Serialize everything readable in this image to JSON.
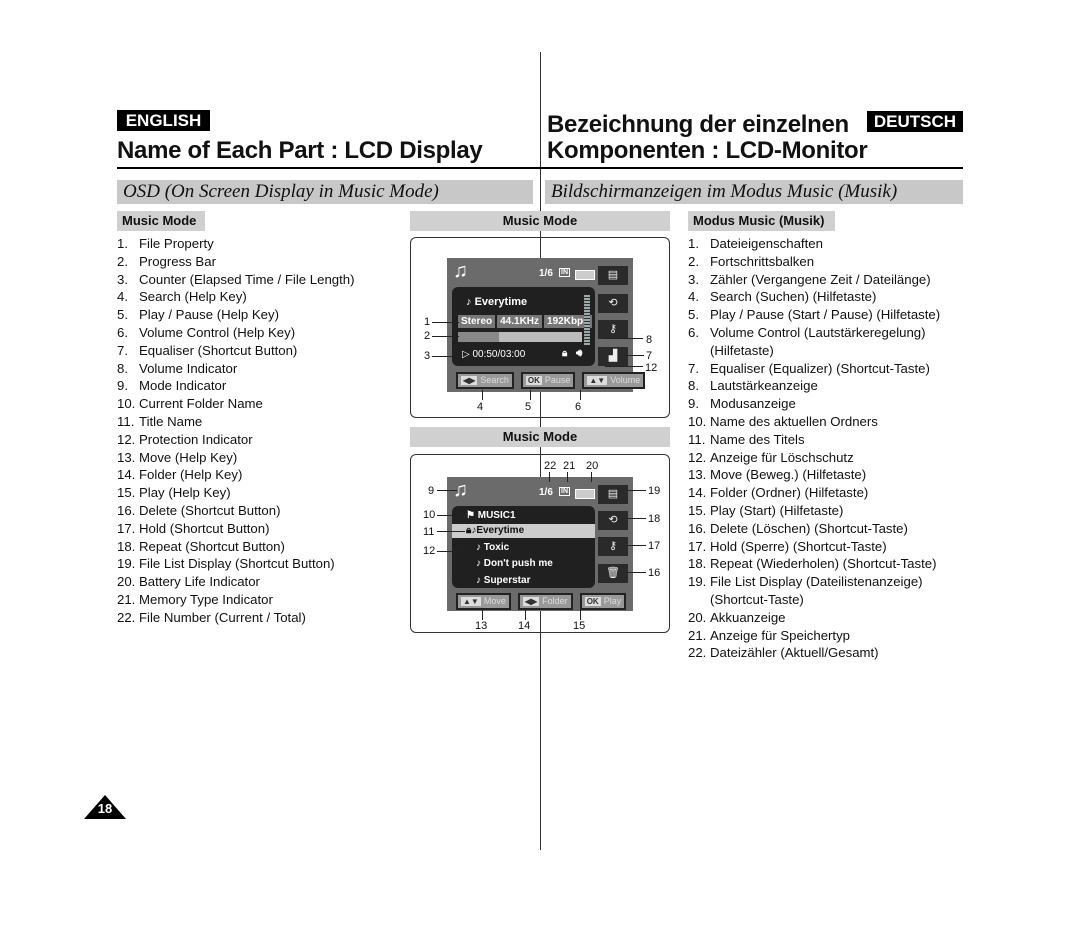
{
  "left": {
    "badge": "ENGLISH",
    "title": "Name of Each Part : LCD Display",
    "section": "OSD (On Screen Display in Music Mode)",
    "subhead": "Music Mode",
    "items": [
      [
        "1.",
        "File Property"
      ],
      [
        "2.",
        "Progress Bar"
      ],
      [
        "3.",
        "Counter (Elapsed Time / File Length)"
      ],
      [
        "4.",
        "Search (Help Key)"
      ],
      [
        "5.",
        "Play / Pause (Help Key)"
      ],
      [
        "6.",
        "Volume Control (Help Key)"
      ],
      [
        "7.",
        "Equaliser (Shortcut Button)"
      ],
      [
        "8.",
        "Volume Indicator"
      ],
      [
        "9.",
        "Mode Indicator"
      ],
      [
        "10.",
        "Current Folder Name"
      ],
      [
        "11.",
        "Title Name"
      ],
      [
        "12.",
        "Protection Indicator"
      ],
      [
        "13.",
        "Move (Help Key)"
      ],
      [
        "14.",
        "Folder (Help Key)"
      ],
      [
        "15.",
        "Play (Help Key)"
      ],
      [
        "16.",
        "Delete (Shortcut Button)"
      ],
      [
        "17.",
        "Hold (Shortcut Button)"
      ],
      [
        "18.",
        "Repeat (Shortcut Button)"
      ],
      [
        "19.",
        "File List Display (Shortcut Button)"
      ],
      [
        "20.",
        "Battery Life Indicator"
      ],
      [
        "21.",
        "Memory Type Indicator"
      ],
      [
        "22.",
        "File Number (Current / Total)"
      ]
    ]
  },
  "right": {
    "badge": "DEUTSCH",
    "title1": "Bezeichnung der einzelnen",
    "title2": "Komponenten : LCD-Monitor",
    "section": "Bildschirmanzeigen im Modus Music (Musik)",
    "subhead": "Modus Music (Musik)",
    "items": [
      [
        "1.",
        "Dateieigenschaften"
      ],
      [
        "2.",
        "Fortschrittsbalken"
      ],
      [
        "3.",
        "Zähler (Vergangene Zeit / Dateilänge)"
      ],
      [
        "4.",
        "Search (Suchen) (Hilfetaste)"
      ],
      [
        "5.",
        "Play / Pause (Start / Pause) (Hilfetaste)"
      ],
      [
        "6.",
        "Volume Control (Lautstärkeregelung)"
      ],
      [
        "",
        "(Hilfetaste)"
      ],
      [
        "7.",
        "Equaliser (Equalizer) (Shortcut-Taste)"
      ],
      [
        "8.",
        "Lautstärkeanzeige"
      ],
      [
        "9.",
        "Modusanzeige"
      ],
      [
        "10.",
        "Name des aktuellen Ordners"
      ],
      [
        "11.",
        "Name des Titels"
      ],
      [
        "12.",
        "Anzeige für Löschschutz"
      ],
      [
        "13.",
        "Move (Beweg.) (Hilfetaste)"
      ],
      [
        "14.",
        "Folder (Ordner) (Hilfetaste)"
      ],
      [
        "15.",
        "Play (Start) (Hilfetaste)"
      ],
      [
        "16.",
        "Delete (Löschen) (Shortcut-Taste)"
      ],
      [
        "17.",
        "Hold (Sperre) (Shortcut-Taste)"
      ],
      [
        "18.",
        "Repeat (Wiederholen) (Shortcut-Taste)"
      ],
      [
        "19.",
        "File List Display (Dateilistenanzeige)"
      ],
      [
        "",
        "(Shortcut-Taste)"
      ],
      [
        "20.",
        "Akkuanzeige"
      ],
      [
        "21.",
        "Anzeige für Speichertyp"
      ],
      [
        "22.",
        "Dateizähler (Aktuell/Gesamt)"
      ]
    ]
  },
  "screen1": {
    "header": "Music Mode",
    "file_number": "1/6",
    "memory": "IN",
    "title": "Everytime",
    "props": [
      "Stereo",
      "44.1KHz",
      "192Kbps"
    ],
    "progress": 0.33,
    "counter": "00:50/03:00",
    "keys": [
      [
        "◀▶",
        "Search"
      ],
      [
        "OK",
        "Pause"
      ],
      [
        "▲▼",
        "Volume"
      ]
    ],
    "callouts": [
      "1",
      "2",
      "3",
      "4",
      "5",
      "6",
      "7",
      "8",
      "12"
    ]
  },
  "screen2": {
    "header": "Music Mode",
    "file_number": "1/6",
    "memory": "IN",
    "folder": "MUSIC1",
    "tracks": [
      "Everytime",
      "Toxic",
      "Don't push me",
      "Superstar"
    ],
    "keys": [
      [
        "▲▼",
        "Move"
      ],
      [
        "◀▶",
        "Folder"
      ],
      [
        "OK",
        "Play"
      ]
    ],
    "callouts": [
      "9",
      "10",
      "11",
      "12",
      "13",
      "14",
      "15",
      "16",
      "17",
      "18",
      "19",
      "20",
      "21",
      "22"
    ]
  },
  "page_number": "18"
}
